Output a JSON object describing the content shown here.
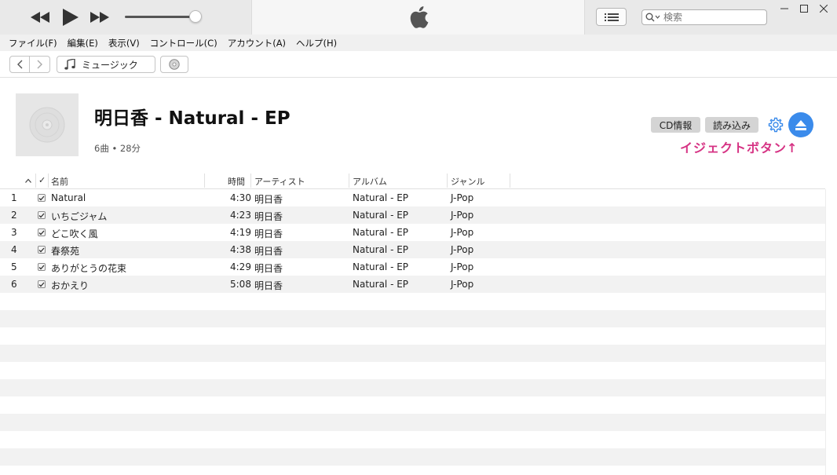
{
  "menu": [
    "ファイル(F)",
    "編集(E)",
    "表示(V)",
    "コントロール(C)",
    "アカウント(A)",
    "ヘルプ(H)"
  ],
  "search": {
    "placeholder": "検索"
  },
  "nav": {
    "media_label": "ミュージック"
  },
  "album": {
    "title": "明日香 - Natural - EP",
    "subtitle": "6曲 • 28分"
  },
  "header_buttons": {
    "cd_info": "CD情報",
    "import": "読み込み"
  },
  "annotation": "イジェクトボタン↑",
  "columns": {
    "check": "✓",
    "name": "名前",
    "time": "時間",
    "artist": "アーティスト",
    "album": "アルバム",
    "genre": "ジャンル"
  },
  "tracks": [
    {
      "num": "1",
      "name": "Natural",
      "time": "4:30",
      "artist": "明日香",
      "album": "Natural - EP",
      "genre": "J-Pop"
    },
    {
      "num": "2",
      "name": "いちごジャム",
      "time": "4:23",
      "artist": "明日香",
      "album": "Natural - EP",
      "genre": "J-Pop"
    },
    {
      "num": "3",
      "name": "どこ吹く風",
      "time": "4:19",
      "artist": "明日香",
      "album": "Natural - EP",
      "genre": "J-Pop"
    },
    {
      "num": "4",
      "name": "春祭苑",
      "time": "4:38",
      "artist": "明日香",
      "album": "Natural - EP",
      "genre": "J-Pop"
    },
    {
      "num": "5",
      "name": "ありがとうの花束",
      "time": "4:29",
      "artist": "明日香",
      "album": "Natural - EP",
      "genre": "J-Pop"
    },
    {
      "num": "6",
      "name": "おかえり",
      "time": "5:08",
      "artist": "明日香",
      "album": "Natural - EP",
      "genre": "J-Pop"
    }
  ],
  "colors": {
    "accent": "#3b8beb",
    "annotation": "#d63384",
    "row_alt": "#f2f2f2"
  },
  "icons": [
    "rewind-icon",
    "play-icon",
    "fast-forward-icon",
    "apple-logo-icon",
    "list-icon",
    "search-icon",
    "minimize-icon",
    "maximize-icon",
    "close-icon",
    "chevron-left-icon",
    "chevron-right-icon",
    "music-note-icon",
    "cd-icon",
    "gear-icon",
    "eject-icon"
  ]
}
